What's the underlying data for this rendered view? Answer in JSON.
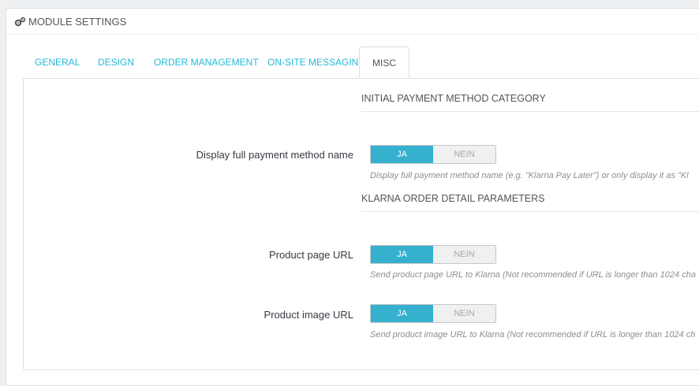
{
  "panel": {
    "heading_icon": "cogs-icon",
    "heading": "MODULE SETTINGS"
  },
  "tabs": [
    {
      "label": "GENERAL"
    },
    {
      "label": "DESIGN"
    },
    {
      "label": "ORDER MANAGEMENT"
    },
    {
      "label": "ON-SITE MESSAGING"
    },
    {
      "label": "MISC",
      "active": true
    }
  ],
  "sections": {
    "payment_category": "INITIAL PAYMENT METHOD CATEGORY",
    "order_detail": "KLARNA ORDER DETAIL PARAMETERS"
  },
  "settings": {
    "full_name": {
      "label": "Display full payment method name",
      "yes": "JA",
      "no": "NEIN",
      "value": "JA",
      "help": "Display full payment method name (e.g. \"Klarna Pay Later\") or only display it as \"Kl"
    },
    "product_page_url": {
      "label": "Product page URL",
      "yes": "JA",
      "no": "NEIN",
      "value": "JA",
      "help": "Send product page URL to Klarna (Not recommended if URL is longer than 1024 cha"
    },
    "product_image_url": {
      "label": "Product image URL",
      "yes": "JA",
      "no": "NEIN",
      "value": "JA",
      "help": "Send product image URL to Klarna (Not recommended if URL is longer than 1024 ch"
    }
  },
  "colors": {
    "accent": "#25b9d7",
    "switch_on": "#35b0cf"
  }
}
